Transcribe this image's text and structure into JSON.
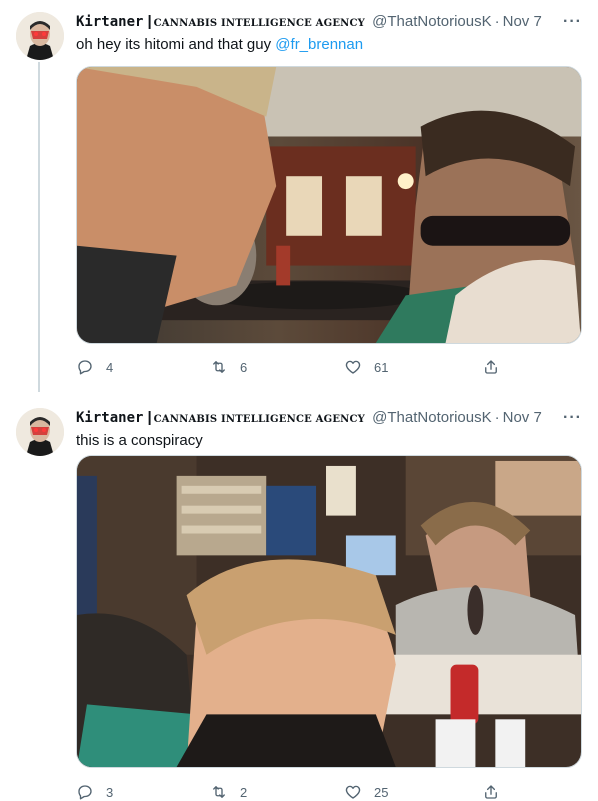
{
  "colors": {
    "link": "#1d9bf0",
    "secondary": "#536471",
    "divider": "#cfd9de"
  },
  "tweets": [
    {
      "display_name": "Kirtaner",
      "name_separator": "|",
      "name_suffix": "CANNABIS INTELLIGENCE AGENCY",
      "handle": "@ThatNotoriousK",
      "date": "Nov 7",
      "more": "···",
      "text": "oh hey its hitomi and that guy ",
      "mention": "@fr_brennan",
      "replies": "4",
      "retweets": "6",
      "likes": "61",
      "media_icon": "photo"
    },
    {
      "display_name": "Kirtaner",
      "name_separator": "|",
      "name_suffix": "CANNABIS INTELLIGENCE AGENCY",
      "handle": "@ThatNotoriousK",
      "date": "Nov 7",
      "more": "···",
      "text": "this is a conspiracy",
      "mention": "",
      "replies": "3",
      "retweets": "2",
      "likes": "25",
      "media_icon": "photo"
    }
  ],
  "icons": {
    "reply": "reply-icon",
    "retweet": "retweet-icon",
    "like": "heart-icon",
    "share": "share-icon",
    "more": "more-icon"
  }
}
